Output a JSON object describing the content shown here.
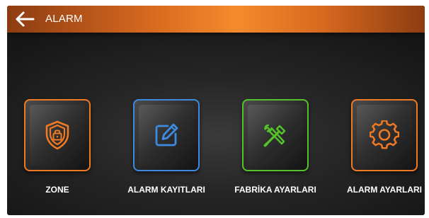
{
  "header": {
    "title": "ALARM",
    "back_icon": "arrow-left-icon"
  },
  "tiles": [
    {
      "label": "ZONE",
      "icon": "shield-lock-icon",
      "color": "#f07a24"
    },
    {
      "label": "ALARM KAYITLARI",
      "icon": "edit-icon",
      "color": "#3d8ae0"
    },
    {
      "label": "FABRİKA AYARLARI",
      "icon": "tools-icon",
      "color": "#56c22b"
    },
    {
      "label": "ALARM AYARLARI",
      "icon": "gear-icon",
      "color": "#f07a24"
    }
  ],
  "colors": {
    "header_orange": "#f58a2d",
    "background": "#262626"
  }
}
